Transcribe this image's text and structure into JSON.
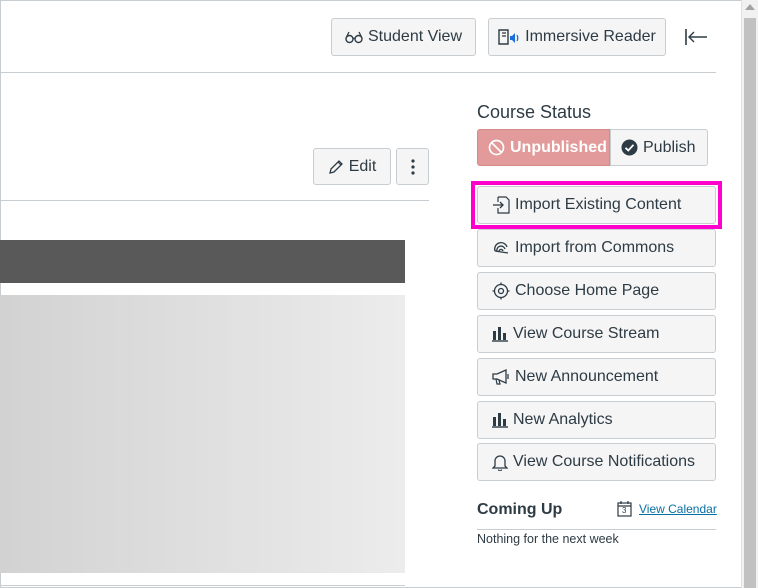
{
  "header": {
    "student_view": "Student View",
    "immersive_reader": "Immersive Reader"
  },
  "content": {
    "edit": "Edit"
  },
  "sidebar": {
    "course_status": "Course Status",
    "unpublished": "Unpublished",
    "publish": "Publish",
    "actions": [
      {
        "label": "Import Existing Content",
        "icon": "import-icon",
        "highlighted": true
      },
      {
        "label": "Import from Commons",
        "icon": "commons-icon"
      },
      {
        "label": "Choose Home Page",
        "icon": "target-icon"
      },
      {
        "label": "View Course Stream",
        "icon": "bar-chart-icon"
      },
      {
        "label": "New Announcement",
        "icon": "megaphone-icon"
      },
      {
        "label": "New Analytics",
        "icon": "bar-chart-icon"
      },
      {
        "label": "View Course Notifications",
        "icon": "bell-icon"
      }
    ],
    "coming_up": "Coming Up",
    "calendar_day": "3",
    "view_calendar": "View Calendar",
    "nothing": "Nothing for the next week"
  },
  "colors": {
    "highlight": "#ff00cc",
    "unpublished_bg": "#e29a9a",
    "link": "#0770a3",
    "banner": "#595959"
  }
}
